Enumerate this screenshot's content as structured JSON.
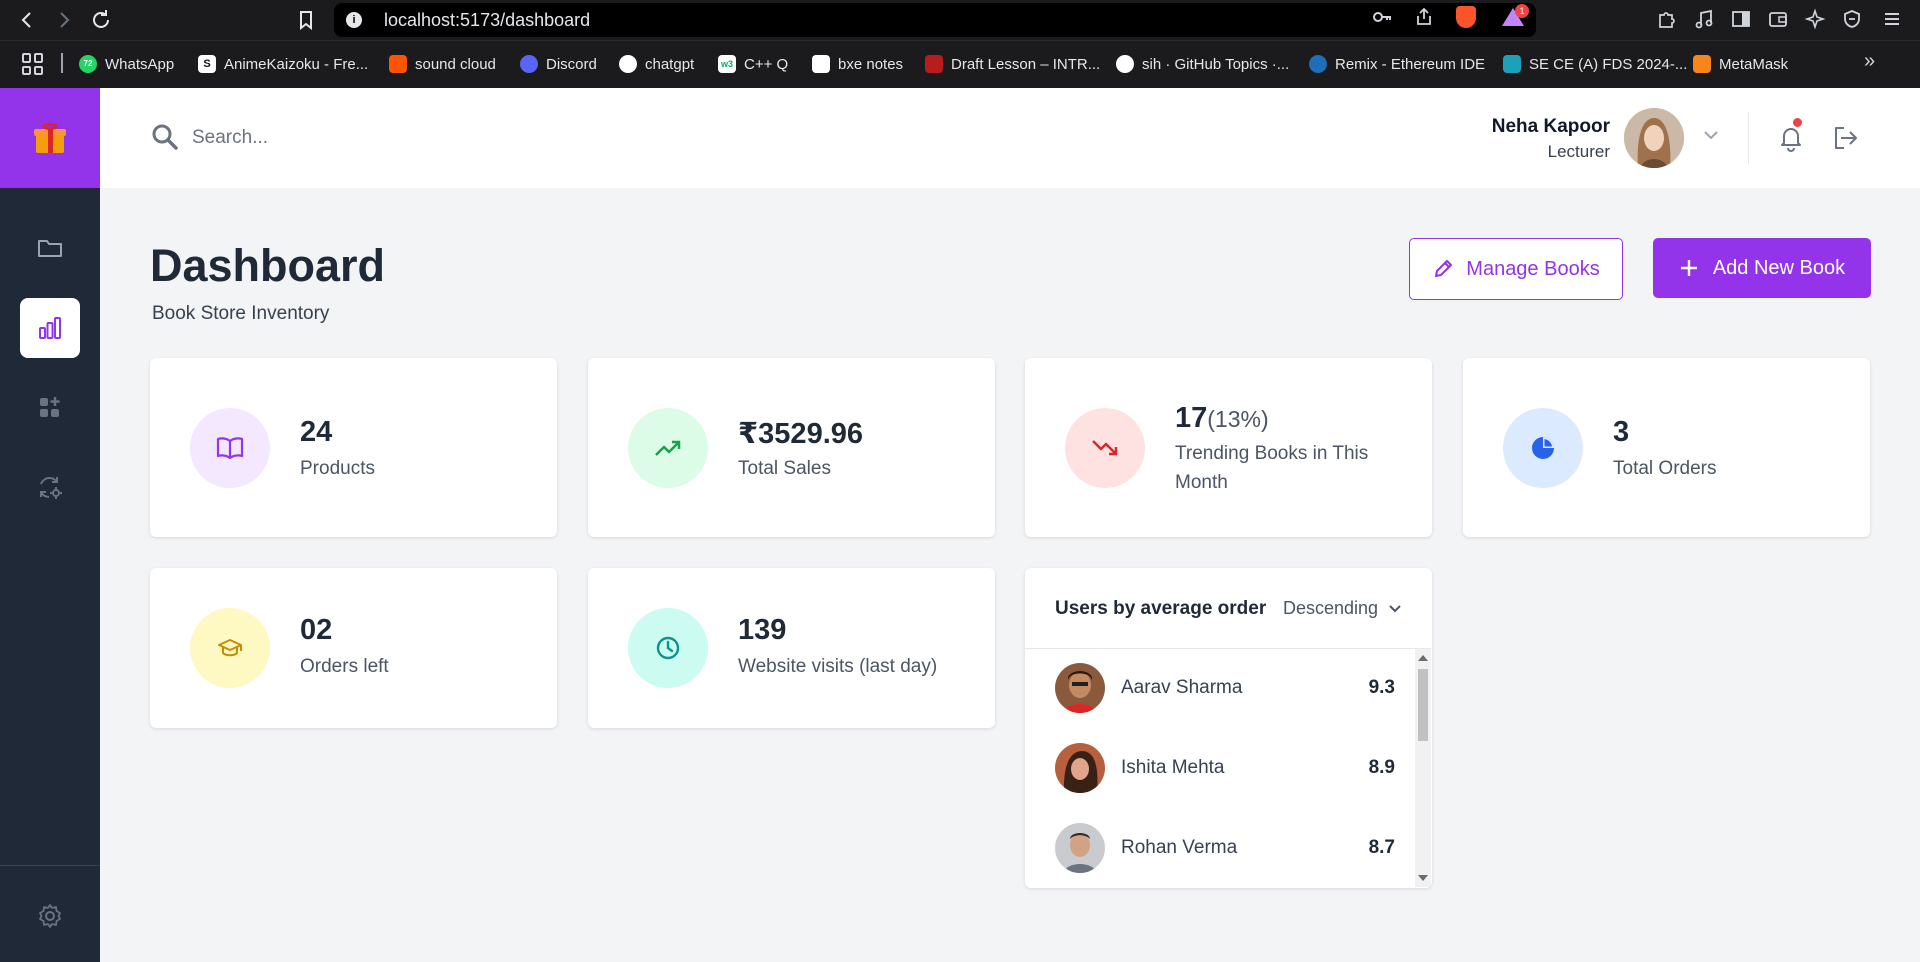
{
  "browser": {
    "url": "localhost:5173/dashboard",
    "url_info_glyph": "i",
    "brave_badge": "1",
    "bookmarks": [
      {
        "label": "WhatsApp",
        "icon": "whatsapp-icon",
        "color": "#25d366",
        "glyph": "72"
      },
      {
        "label": "AnimeKaizoku - Fre...",
        "icon": "animekaizoku-icon",
        "color": "#ffffff",
        "glyph": "S"
      },
      {
        "label": "sound cloud",
        "icon": "soundcloud-icon",
        "color": "#ff5500",
        "glyph": ""
      },
      {
        "label": "Discord",
        "icon": "discord-icon",
        "color": "#5865f2",
        "glyph": ""
      },
      {
        "label": "chatgpt",
        "icon": "chatgpt-icon",
        "color": "#ffffff",
        "glyph": ""
      },
      {
        "label": "C++ Q",
        "icon": "w3schools-icon",
        "color": "#ffffff",
        "glyph": "w3"
      },
      {
        "label": "bxe notes",
        "icon": "notes-icon",
        "color": "#ffffff",
        "glyph": ""
      },
      {
        "label": "Draft Lesson – INTR...",
        "icon": "draft-lesson-icon",
        "color": "#b91c1c",
        "glyph": ""
      },
      {
        "label": "sih · GitHub Topics ·...",
        "icon": "github-icon",
        "color": "#ffffff",
        "glyph": ""
      },
      {
        "label": "Remix - Ethereum IDE",
        "icon": "remix-icon",
        "color": "#1e6fb8",
        "glyph": ""
      },
      {
        "label": "SE CE (A) FDS 2024-...",
        "icon": "classroom-icon",
        "color": "#1da1b8",
        "glyph": ""
      },
      {
        "label": "MetaMask",
        "icon": "metamask-icon",
        "color": "#f6851b",
        "glyph": ""
      }
    ]
  },
  "search": {
    "placeholder": "Search..."
  },
  "user": {
    "name": "Neha Kapoor",
    "role": "Lecturer"
  },
  "page": {
    "title": "Dashboard",
    "subtitle": "Book Store Inventory"
  },
  "actions": {
    "manage_label": "Manage Books",
    "add_label": "Add New Book"
  },
  "stats": [
    {
      "value": "24",
      "label": "Products",
      "icon": "book-icon",
      "bg": "#f3e8ff",
      "fg": "#9333ea"
    },
    {
      "value": "₹3529.96",
      "label": "Total Sales",
      "icon": "trending-up-icon",
      "bg": "#dcfce7",
      "fg": "#16a34a"
    },
    {
      "value": "17",
      "extra": "(13%)",
      "label": "Trending Books in This Month",
      "icon": "trending-down-icon",
      "bg": "#fee2e2",
      "fg": "#dc2626"
    },
    {
      "value": "3",
      "label": "Total Orders",
      "icon": "pie-chart-icon",
      "bg": "#dbeafe",
      "fg": "#2563eb"
    },
    {
      "value": "02",
      "label": "Orders left",
      "icon": "graduation-cap-icon",
      "bg": "#fef9c3",
      "fg": "#ca8a04"
    },
    {
      "value": "139",
      "label": "Website visits (last day)",
      "icon": "clock-icon",
      "bg": "#ccfbf1",
      "fg": "#0d9488"
    }
  ],
  "users_by_order": {
    "title": "Users by average order",
    "sort": "Descending",
    "rows": [
      {
        "name": "Aarav Sharma",
        "score": "9.3"
      },
      {
        "name": "Ishita Mehta",
        "score": "8.9"
      },
      {
        "name": "Rohan Verma",
        "score": "8.7"
      }
    ]
  },
  "colors": {
    "accent": "#9333ea",
    "sidebar": "#1f2937",
    "background": "#f3f4f6"
  }
}
